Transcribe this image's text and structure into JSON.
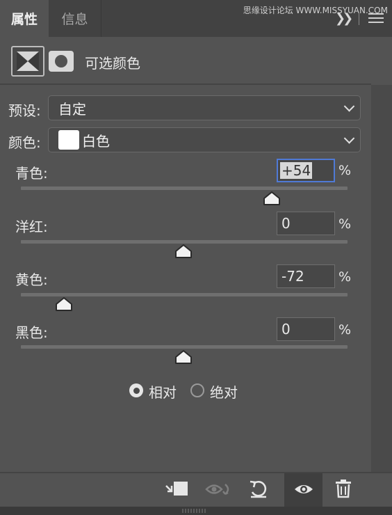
{
  "tabs": [
    {
      "label": "属性",
      "active": true
    },
    {
      "label": "信息",
      "active": false
    }
  ],
  "watermark": "思缘设计论坛 WWW.MISSYUAN.COM",
  "icons": {
    "collapse": "double-chevron-right-icon",
    "menu": "hamburger-menu-icon"
  },
  "header": {
    "title": "可选颜色"
  },
  "preset": {
    "label": "预设:",
    "value": "自定"
  },
  "colors": {
    "label": "颜色:",
    "value": "白色",
    "swatch_color": "#ffffff"
  },
  "sliders": [
    {
      "label": "青色:",
      "value": "+54",
      "numeric": 54,
      "focused": true
    },
    {
      "label": "洋红:",
      "value": "0",
      "numeric": 0,
      "focused": false
    },
    {
      "label": "黄色:",
      "value": "-72",
      "numeric": -72,
      "focused": false
    },
    {
      "label": "黑色:",
      "value": "0",
      "numeric": 0,
      "focused": false
    }
  ],
  "percent_symbol": "%",
  "method": {
    "options": [
      {
        "label": "相对",
        "selected": true
      },
      {
        "label": "绝对",
        "selected": false
      }
    ]
  },
  "footer_icons": [
    "clip-to-layer-icon",
    "view-previous-state-icon",
    "reset-icon",
    "visibility-eye-icon",
    "trash-icon"
  ],
  "accent_color": "#4f7ad6"
}
